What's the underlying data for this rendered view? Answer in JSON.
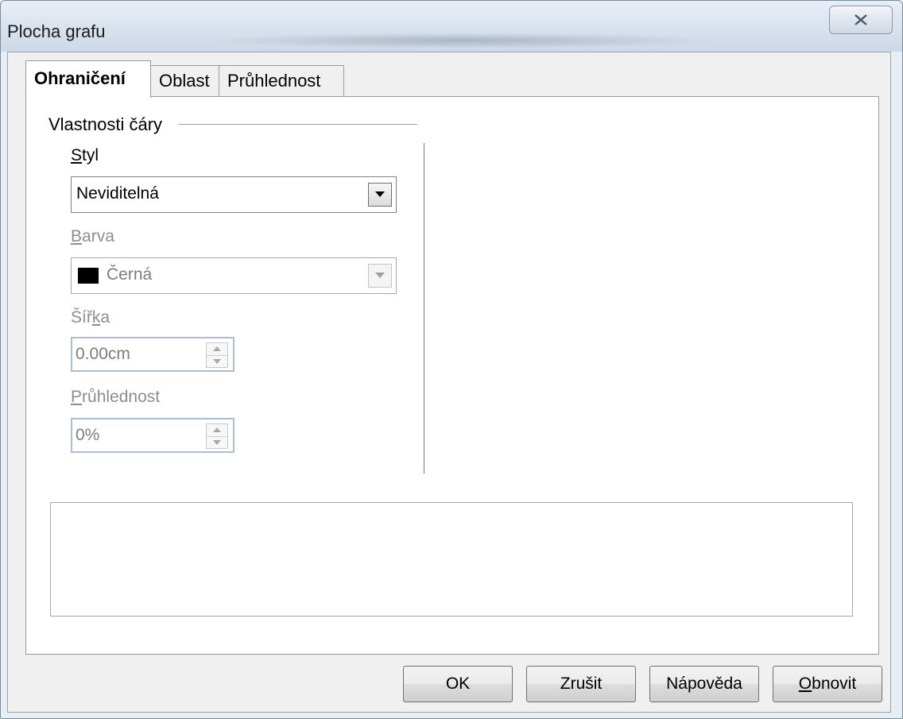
{
  "window": {
    "title": "Plocha grafu"
  },
  "tabs": [
    {
      "label": "Ohraničení",
      "active": true
    },
    {
      "label": "Oblast",
      "active": false
    },
    {
      "label": "Průhlednost",
      "active": false
    }
  ],
  "line_properties": {
    "group_title": "Vlastnosti čáry",
    "style": {
      "label_first": "S",
      "label_rest": "tyl",
      "value": "Neviditelná"
    },
    "color": {
      "label_first": "B",
      "label_rest": "arva",
      "value": "Černá",
      "swatch": "#000000"
    },
    "width": {
      "label_pre": "Šíř",
      "label_ul": "k",
      "label_post": "a",
      "value": "0.00cm"
    },
    "transparency": {
      "label_first": "P",
      "label_rest": "růhlednost",
      "value": "0%"
    }
  },
  "buttons": {
    "ok": "OK",
    "cancel": "Zrušit",
    "help": "Nápověda",
    "reset_ul": "O",
    "reset_rest": "bnovit"
  },
  "icons": {
    "close": "close-icon",
    "dropdown": "chevron-down-icon",
    "spin_up": "spin-up-icon",
    "spin_down": "spin-down-icon"
  }
}
